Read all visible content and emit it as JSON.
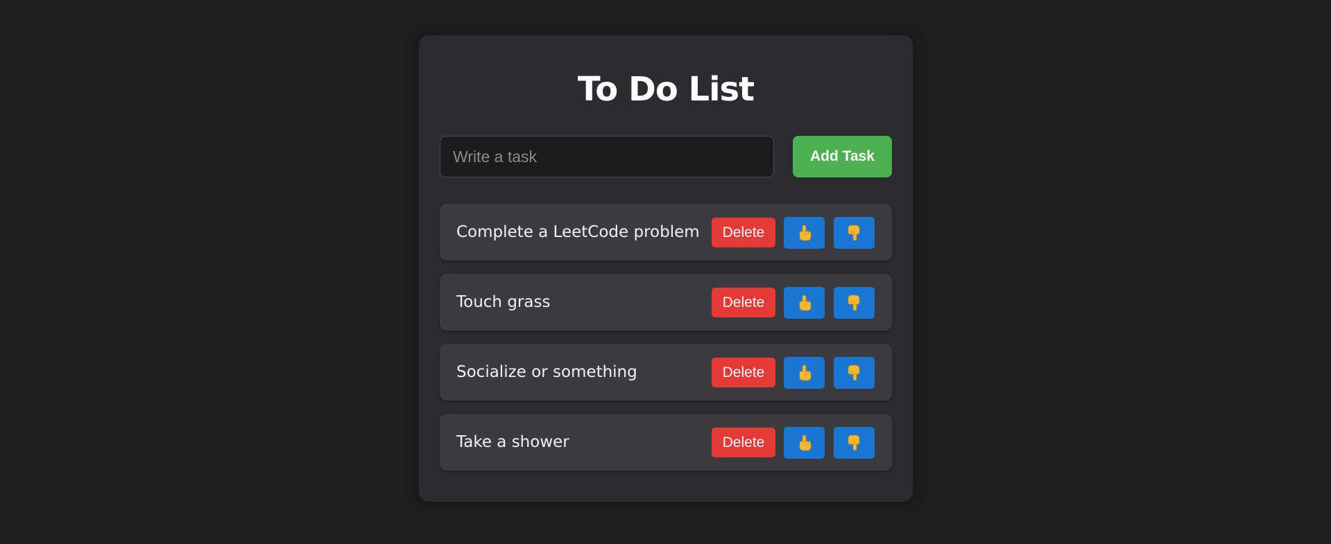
{
  "app": {
    "title": "To Do List"
  },
  "input": {
    "placeholder": "Write a task",
    "value": ""
  },
  "add_button": {
    "label": "Add Task"
  },
  "tasks": [
    {
      "text": "Complete a LeetCode problem",
      "delete_label": "Delete"
    },
    {
      "text": "Touch grass",
      "delete_label": "Delete"
    },
    {
      "text": "Socialize or something",
      "delete_label": "Delete"
    },
    {
      "text": "Take a shower",
      "delete_label": "Delete"
    }
  ],
  "icons": {
    "move_up": "pointing-up-hand-icon",
    "move_down": "pointing-down-hand-icon"
  },
  "colors": {
    "background": "#1e1e1e",
    "card": "#2b2b30",
    "task_item": "#3a3a3f",
    "add_button": "#4caf50",
    "delete_button": "#e53935",
    "move_button": "#1976d2",
    "hand_icon": "#f5b930"
  }
}
